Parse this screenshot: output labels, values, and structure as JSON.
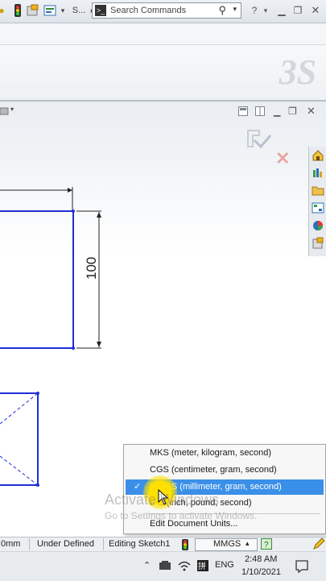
{
  "toolbar": {
    "truncated_label": "S...",
    "search_placeholder": "Search Commands",
    "help_label": "?",
    "icons": [
      "bulb-icon",
      "traffic-light-icon",
      "options-icon",
      "form-icon",
      "command-icon",
      "search-icon",
      "help-icon",
      "minimize-icon",
      "restore-icon",
      "close-icon"
    ]
  },
  "brand": {
    "logo_text": "3S"
  },
  "viewport": {
    "dimension_100": "100"
  },
  "units_menu": {
    "items": [
      {
        "label": "MKS  (meter, kilogram, second)",
        "selected": false
      },
      {
        "label": "CGS  (centimeter, gram, second)",
        "selected": false
      },
      {
        "label": "MMGS  (millimeter, gram, second)",
        "selected": true
      },
      {
        "label": "IPS  (inch, pound, second)",
        "selected": false
      },
      {
        "label": "Edit Document Units...",
        "selected": false
      }
    ],
    "check_glyph": "✓"
  },
  "watermark": {
    "line1": "Activate Windows",
    "line2": "Go to Settings to activate Windows."
  },
  "status_bar": {
    "coord_fragment": "0mm",
    "sketch_state": "Under Defined",
    "mode": "Editing Sketch1",
    "units": "MMGS",
    "units_caret": "▴"
  },
  "taskbar": {
    "language": "ENG",
    "time": "2:48 AM",
    "date": "1/10/2021"
  },
  "colors": {
    "sketch_line": "#1f2fd6",
    "selection": "#3a90e8",
    "cursor_highlight": "#ffe000"
  }
}
